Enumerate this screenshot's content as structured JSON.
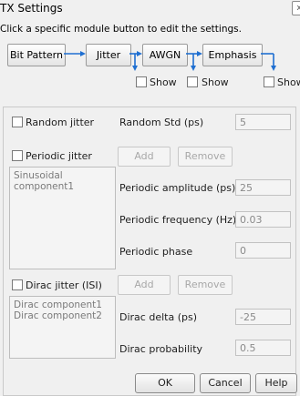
{
  "window": {
    "title": "TX Settings",
    "close_glyph": "x"
  },
  "instructions": "Click a specific module button to edit the settings.",
  "modules": {
    "bit_pattern": "Bit Pattern",
    "jitter": "Jitter",
    "awgn": "AWGN",
    "emphasis": "Emphasis",
    "show_label": "Show"
  },
  "random_jitter": {
    "checkbox_label": "Random jitter",
    "std_label": "Random Std (ps)",
    "std_value": "5"
  },
  "periodic_jitter": {
    "checkbox_label": "Periodic jitter",
    "add_label": "Add",
    "remove_label": "Remove",
    "components": [
      "Sinusoidal component1"
    ],
    "amplitude_label": "Periodic amplitude (ps)",
    "amplitude_value": "25",
    "frequency_label": "Periodic frequency (Hz)",
    "frequency_value": "0.03",
    "phase_label": "Periodic phase",
    "phase_value": "0"
  },
  "dirac_jitter": {
    "checkbox_label": "Dirac jitter (ISI)",
    "add_label": "Add",
    "remove_label": "Remove",
    "components": [
      "Dirac component1",
      "Dirac component2"
    ],
    "delta_label": "Dirac delta (ps)",
    "delta_value": "-25",
    "probability_label": "Dirac probability",
    "probability_value": "0.5"
  },
  "actions": {
    "ok": "OK",
    "cancel": "Cancel",
    "help": "Help"
  },
  "colors": {
    "arrow": "#1f6fd1",
    "background": "#f0f0f0"
  }
}
